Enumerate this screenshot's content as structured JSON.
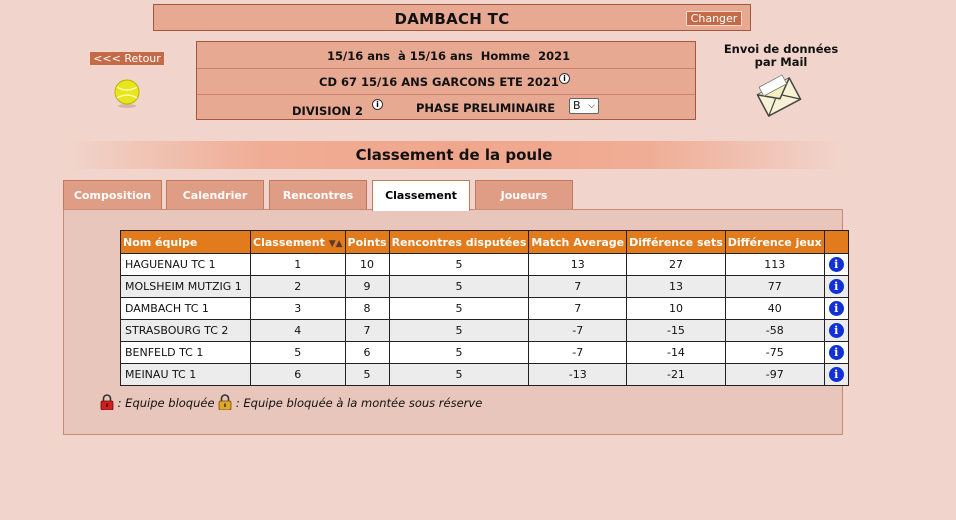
{
  "club": {
    "name": "DAMBACH TC",
    "change_label": "Changer"
  },
  "nav": {
    "back_label": "<<< Retour"
  },
  "competition": {
    "age_line": "15/16 ans  à 15/16 ans  Homme  2021",
    "name": "CD 67 15/16 ANS GARCONS ETE 2021",
    "division": "DIVISION 2",
    "phase": "PHASE PRELIMINAIRE",
    "group_value": "B"
  },
  "mail": {
    "line1": "Envoi de données",
    "line2": "par Mail"
  },
  "section": {
    "title": "Classement de la poule"
  },
  "tabs": [
    {
      "label": "Composition"
    },
    {
      "label": "Calendrier"
    },
    {
      "label": "Rencontres"
    },
    {
      "label": "Classement"
    },
    {
      "label": "Joueurs"
    }
  ],
  "table": {
    "headers": [
      "Nom équipe",
      "Classement",
      "Points",
      "Rencontres disputées",
      "Match Average",
      "Différence sets",
      "Différence jeux"
    ],
    "rows": [
      {
        "team": "HAGUENAU TC 1",
        "rank": "1",
        "points": "10",
        "played": "5",
        "avg": "13",
        "sets": "27",
        "games": "113"
      },
      {
        "team": "MOLSHEIM MUTZIG 1",
        "rank": "2",
        "points": "9",
        "played": "5",
        "avg": "7",
        "sets": "13",
        "games": "77"
      },
      {
        "team": "DAMBACH TC 1",
        "rank": "3",
        "points": "8",
        "played": "5",
        "avg": "7",
        "sets": "10",
        "games": "40"
      },
      {
        "team": "STRASBOURG TC 2",
        "rank": "4",
        "points": "7",
        "played": "5",
        "avg": "-7",
        "sets": "-15",
        "games": "-58"
      },
      {
        "team": "BENFELD TC 1",
        "rank": "5",
        "points": "6",
        "played": "5",
        "avg": "-7",
        "sets": "-14",
        "games": "-75"
      },
      {
        "team": "MEINAU TC 1",
        "rank": "6",
        "points": "5",
        "played": "5",
        "avg": "-13",
        "sets": "-21",
        "games": "-97"
      }
    ]
  },
  "legend": {
    "blocked": ": Equipe bloquée",
    "blocked_reserve": ": Equipe bloquée à la montée sous réserve"
  },
  "colors": {
    "accent_header": "#e17b1b",
    "box_bg": "#e8a993",
    "info_icon": "#1130d8"
  }
}
